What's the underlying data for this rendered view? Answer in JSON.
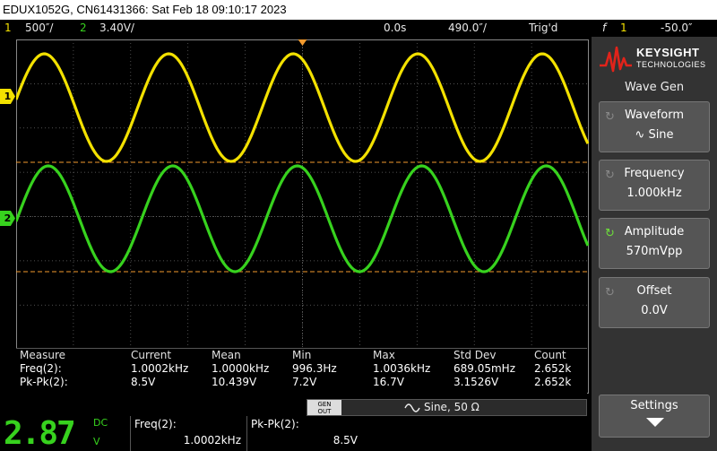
{
  "title_bar": {
    "text": "EDUX1052G, CN61431366: Sat Feb 18 09:10:17 2023"
  },
  "status_bar": {
    "ch1_num": "1",
    "ch1_scale": "500″/",
    "ch2_num": "2",
    "ch2_scale": "3.40V/",
    "time_offset": "0.0s",
    "time_scale": "490.0″/",
    "trigger_state": "Trig'd",
    "trigger_icon": "f",
    "trigger_source": "1",
    "trigger_level": "-50.0″"
  },
  "channel_markers": {
    "ch1": "1",
    "ch2": "2"
  },
  "measurements": {
    "headers": [
      "Measure",
      "Current",
      "Mean",
      "Min",
      "Max",
      "Std Dev",
      "Count"
    ],
    "rows": [
      [
        "Freq(2):",
        "1.0002kHz",
        "1.0000kHz",
        "996.3Hz",
        "1.0036kHz",
        "689.05mHz",
        "2.652k"
      ],
      [
        "Pk-Pk(2):",
        "8.5V",
        "10.439V",
        "7.2V",
        "16.7V",
        "3.1526V",
        "2.652k"
      ]
    ]
  },
  "gen_bar": {
    "button_line1": "GEN",
    "button_line2": "OUT",
    "label": "Sine, 50 Ω"
  },
  "bottom_readout": {
    "big_value": "2.87",
    "coupling": "DC",
    "unit": "V",
    "m1_label": "Freq(2):",
    "m1_value": "1.0002kHz",
    "m2_label": "Pk-Pk(2):",
    "m2_value": "8.5V"
  },
  "side_panel": {
    "logo_brand": "KEYSIGHT",
    "logo_sub": "TECHNOLOGIES",
    "menu_title": "Wave Gen",
    "softkeys": [
      {
        "title": "Waveform",
        "value": "∿ Sine"
      },
      {
        "title": "Frequency",
        "value": "1.000kHz"
      },
      {
        "title": "Amplitude",
        "value": "570mVpp"
      },
      {
        "title": "Offset",
        "value": "0.0V"
      },
      {
        "title": "Settings",
        "value": ""
      }
    ]
  },
  "colors": {
    "ch1": "#f3e100",
    "ch2": "#37d21e",
    "trigger": "#f29a2e",
    "grid": "#6a6a6a"
  },
  "icons": [
    "keysight-logo-icon",
    "knob-icon",
    "trigger-edge-icon",
    "sine-icon",
    "arrow-down-icon"
  ]
}
